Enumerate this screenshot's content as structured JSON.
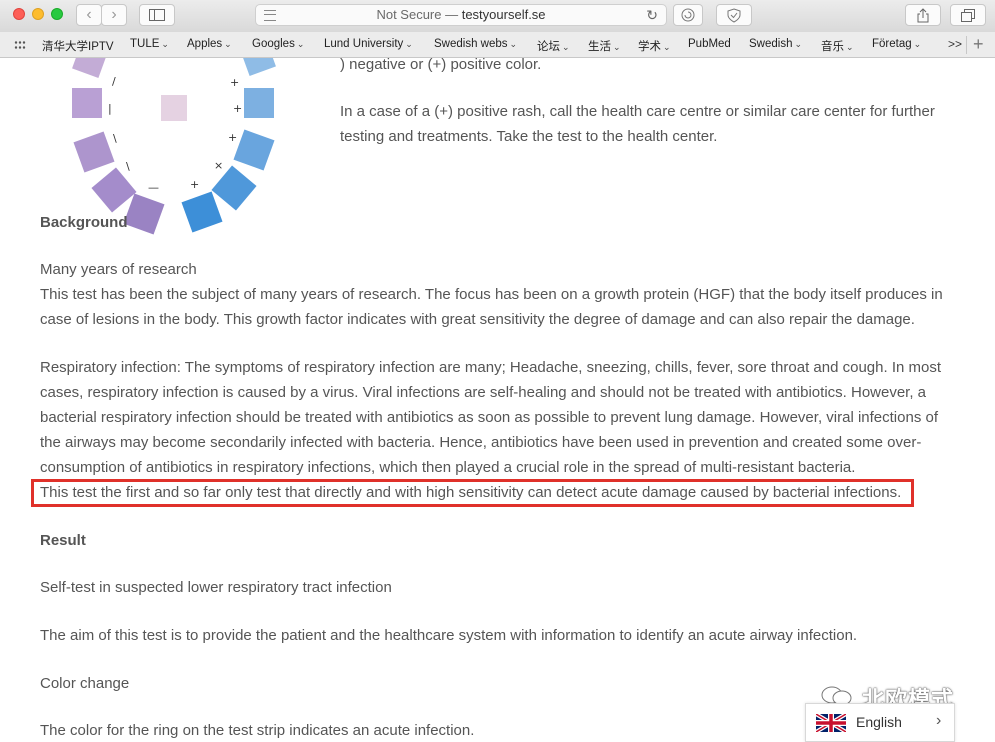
{
  "browser": {
    "url_prefix": "Not Secure — ",
    "url_domain": "testyourself.se",
    "back_icon": "chevron-left-icon",
    "forward_icon": "chevron-right-icon"
  },
  "bookmarks": [
    {
      "label": "清华大学IPTV",
      "chevron": false
    },
    {
      "label": "TULE",
      "chevron": true
    },
    {
      "label": "Apples",
      "chevron": true
    },
    {
      "label": "Googles",
      "chevron": true
    },
    {
      "label": "Lund University",
      "chevron": true
    },
    {
      "label": "Swedish webs",
      "chevron": true
    },
    {
      "label": "论坛",
      "chevron": true
    },
    {
      "label": "生活",
      "chevron": true
    },
    {
      "label": "学术",
      "chevron": true
    },
    {
      "label": "PubMed",
      "chevron": false
    },
    {
      "label": "Swedish",
      "chevron": true
    },
    {
      "label": "音乐",
      "chevron": true
    },
    {
      "label": "Företag",
      "chevron": true
    }
  ],
  "bookmarks_more": ">>",
  "content": {
    "intro_fragment": ") negative or (+) positive color.",
    "rash_paragraph": "In a case of a (+) positive rash, call the health care centre or similar care center for further testing and treatments. Take the test to the health center.",
    "background_heading": "Background",
    "research_subheading": "Many years of research",
    "research_text": "This test has been the subject of many years of research. The focus has been on a growth protein (HGF) that the body itself produces in case of lesions in the body. This growth factor indicates with great sensitivity the degree of damage and can also repair the damage.",
    "respiratory_text": "Respiratory infection: The symptoms of respiratory infection are many; Headache, sneezing, chills, fever, sore throat and cough. In most cases, respiratory infection is caused by a virus. Viral infections are self-healing and should not be treated with antibiotics. However, a bacterial respiratory infection should be treated with antibiotics as soon as possible to prevent lung damage. However, viral infections of the airways may become secondarily infected with bacteria. Hence, antibiotics have been used in prevention and created some over-consumption of antibiotics in respiratory infections, which then played a crucial role in the spread of multi-resistant bacteria.",
    "highlighted_text": "This test the first and so far only test that directly and with high sensitivity can detect acute damage caused by bacterial infections.",
    "result_heading": "Result",
    "selftest_text": "Self-test in suspected lower respiratory tract infection",
    "aim_text": "The aim of this test is to provide the patient and the healthcare system with information to identify an acute airway infection.",
    "color_change_heading": "Color change",
    "ring_text": "The color for the ring on the test strip indicates an acute infection."
  },
  "ring_marks": {
    "left": [
      "/",
      "|",
      "\\",
      "\\",
      "—"
    ],
    "right": [
      "+",
      "+",
      "+",
      "×",
      "+"
    ]
  },
  "colors": {
    "highlight_border": "#e0312a",
    "ring_purple": "#a48ccb",
    "ring_blue": "#3d8fd8"
  },
  "watermark": "北欧模式",
  "language": {
    "label": "English",
    "flag_icon": "uk-flag-icon"
  }
}
